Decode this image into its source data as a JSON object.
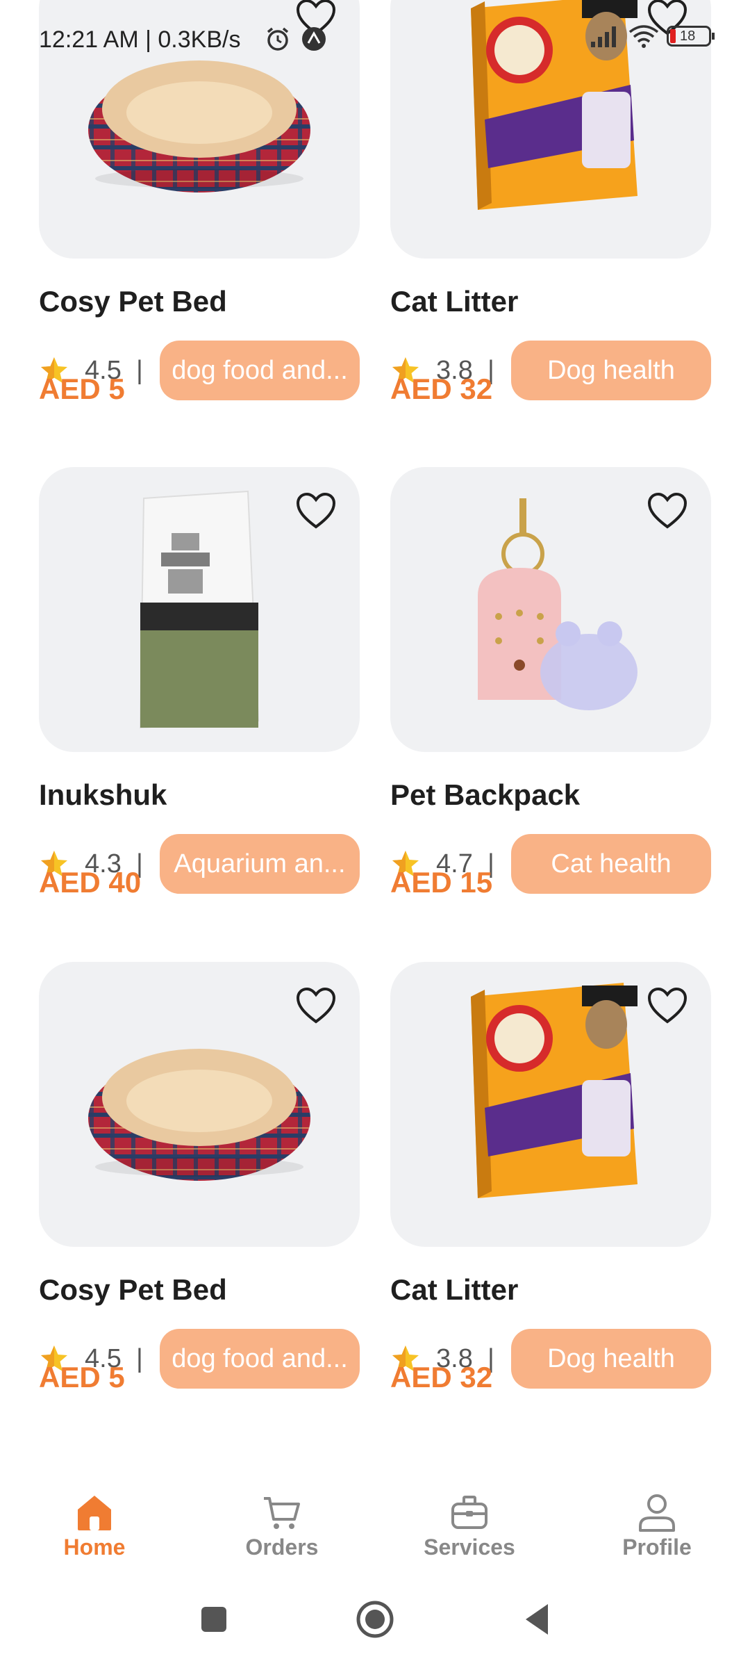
{
  "status_bar": {
    "time": "12:21 AM | 0.3KB/s",
    "battery_level": "18",
    "icons": [
      "alarm-icon",
      "app-notification-icon",
      "signal-icon",
      "wifi-icon",
      "battery-icon"
    ]
  },
  "colors": {
    "accent": "#f07c32",
    "tag_bg": "#f9b286",
    "card_bg": "#f0f1f3"
  },
  "products": [
    {
      "name": "Cosy Pet Bed",
      "rating": "4.5",
      "separator": "|",
      "tag": "dog food and...",
      "price": "AED 5",
      "image": "pet-bed-image"
    },
    {
      "name": "Cat Litter",
      "rating": "3.8",
      "separator": "|",
      "tag": "Dog health",
      "price": "AED 32",
      "image": "cat-litter-box-image"
    },
    {
      "name": "Inukshuk",
      "rating": "4.3",
      "separator": "|",
      "tag": "Aquarium an...",
      "price": "AED 40",
      "image": "dog-food-bag-image"
    },
    {
      "name": "Pet Backpack",
      "rating": "4.7",
      "separator": "|",
      "tag": "Cat health",
      "price": "AED 15",
      "image": "pet-backpack-image"
    },
    {
      "name": "Cosy Pet Bed",
      "rating": "4.5",
      "separator": "|",
      "tag": "dog food and...",
      "price": "AED 5",
      "image": "pet-bed-image"
    },
    {
      "name": "Cat Litter",
      "rating": "3.8",
      "separator": "|",
      "tag": "Dog health",
      "price": "AED 32",
      "image": "cat-litter-box-image"
    }
  ],
  "bottom_nav": {
    "items": [
      {
        "label": "Home",
        "icon": "home-icon",
        "active": true
      },
      {
        "label": "Orders",
        "icon": "cart-icon",
        "active": false
      },
      {
        "label": "Services",
        "icon": "briefcase-icon",
        "active": false
      },
      {
        "label": "Profile",
        "icon": "user-icon",
        "active": false
      }
    ]
  },
  "system_nav": [
    "recents-button",
    "home-button",
    "back-button"
  ]
}
